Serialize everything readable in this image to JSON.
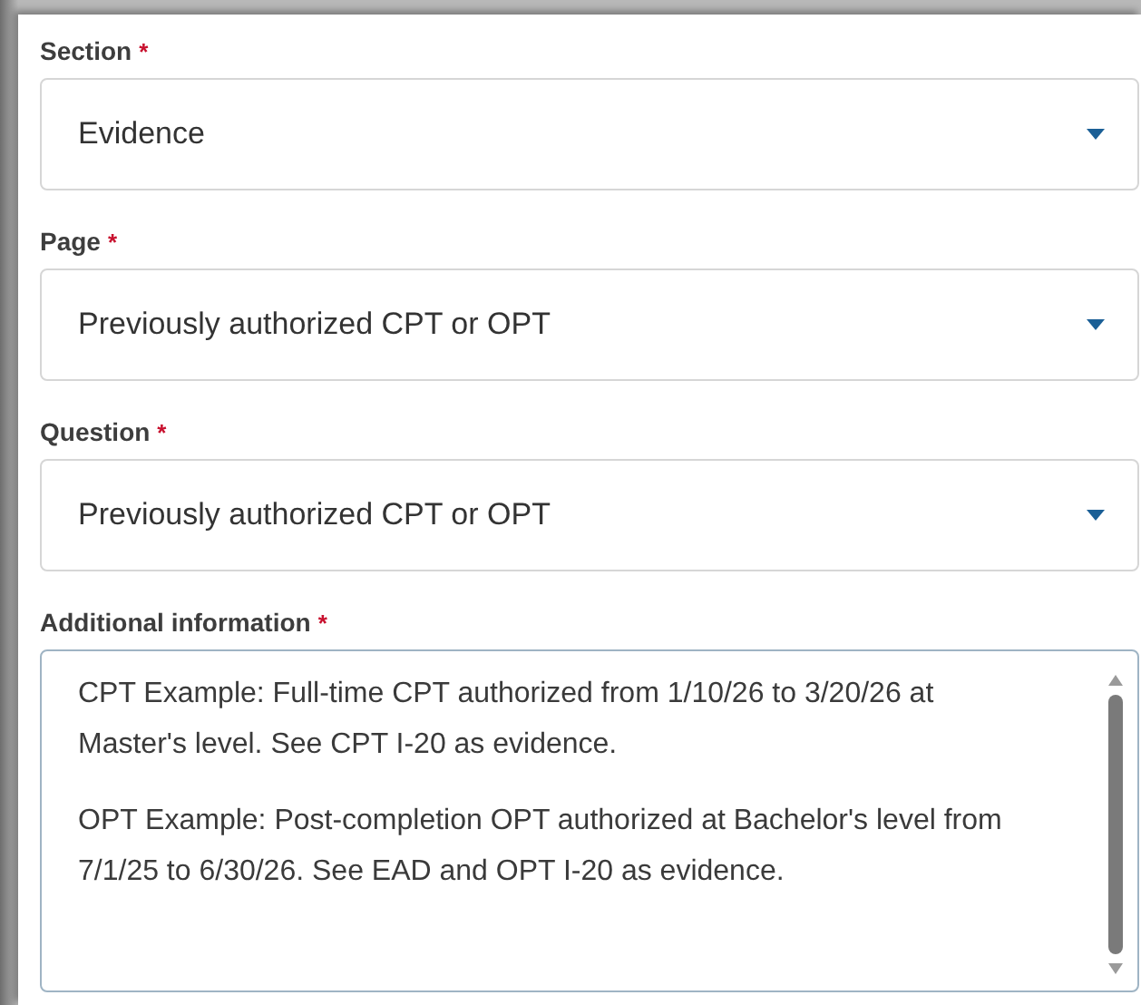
{
  "fields": [
    {
      "kind": "select",
      "label": "Section",
      "required_mark": "*",
      "value": "Evidence"
    },
    {
      "kind": "select",
      "label": "Page",
      "required_mark": "*",
      "value": "Previously authorized CPT or OPT"
    },
    {
      "kind": "select",
      "label": "Question",
      "required_mark": "*",
      "value": "Previously authorized CPT or OPT"
    },
    {
      "kind": "textarea",
      "label": "Additional information",
      "required_mark": "*",
      "paragraphs": [
        "CPT Example: Full-time CPT authorized from 1/10/26 to 3/20/26 at Master's level. See CPT I-20 as evidence.",
        "OPT Example: Post-completion OPT authorized at Bachelor's level from 7/1/25 to 6/30/26. See EAD and OPT I-20 as evidence."
      ]
    }
  ]
}
